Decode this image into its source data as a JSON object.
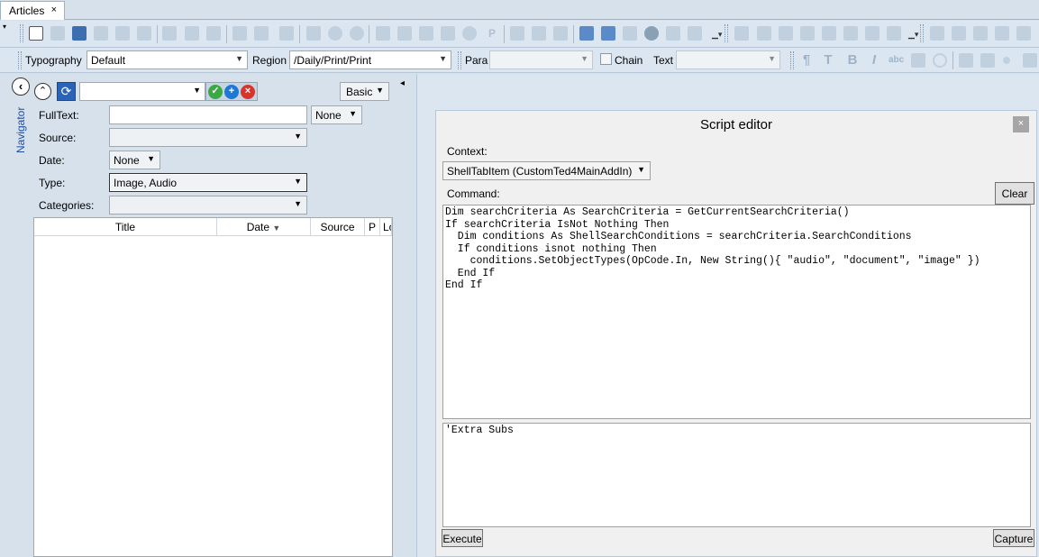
{
  "tabs": [
    {
      "label": "Articles",
      "close": "×"
    }
  ],
  "toolbar2": {
    "typography_label": "Typography",
    "typography_value": "Default",
    "region_label": "Region",
    "region_value": "/Daily/Print/Print",
    "para_label": "Para",
    "para_value": "",
    "chain_label": "Chain",
    "text_label": "Text",
    "text_value": ""
  },
  "navigator": {
    "vertical_label": "Navigator",
    "mode_value": "Basic",
    "fields": {
      "fulltext_label": "FullText:",
      "fulltext_value": "",
      "fulltext_mode": "None",
      "source_label": "Source:",
      "source_value": "",
      "date_label": "Date:",
      "date_value": "None",
      "type_label": "Type:",
      "type_value": "Image, Audio",
      "categories_label": "Categories:",
      "categories_value": ""
    },
    "columns": [
      "Title",
      "Date",
      "Source",
      "P",
      "Lo"
    ]
  },
  "script_editor": {
    "title": "Script editor",
    "close": "×",
    "context_label": "Context:",
    "context_value": "ShellTabItem (CustomTed4MainAddIn)",
    "command_label": "Command:",
    "clear_label": "Clear",
    "command_code": "Dim searchCriteria As SearchCriteria = GetCurrentSearchCriteria()\nIf searchCriteria IsNot Nothing Then\n  Dim conditions As ShellSearchConditions = searchCriteria.SearchConditions\n  If conditions isnot nothing Then\n    conditions.SetObjectTypes(OpCode.In, New String(){ \"audio\", \"document\", \"image\" })\n  End If\nEnd If",
    "extra_code": "'Extra Subs",
    "execute_label": "Execute",
    "capture_label": "Capture"
  },
  "colors": {
    "background": "#d6e1ec",
    "refresh_button": "#2a64b8",
    "ok_icon": "#3aa844",
    "add_icon": "#1e78d6",
    "remove_icon": "#d8342c"
  }
}
